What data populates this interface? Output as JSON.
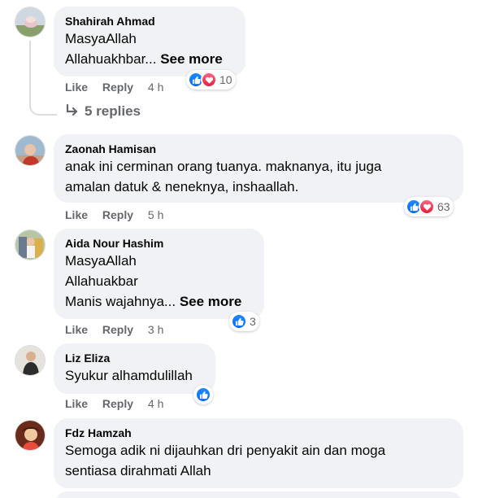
{
  "comments": [
    {
      "author": "Shahirah Ahmad",
      "lines": [
        "MasyaAllah",
        "Allahuakhbar..."
      ],
      "see_more": "See more",
      "actions": {
        "like": "Like",
        "reply": "Reply",
        "time": "4 h"
      },
      "reactions": {
        "types": [
          "like",
          "love"
        ],
        "count": "10"
      },
      "replies": "5 replies"
    },
    {
      "author": "Zaonah Hamisan",
      "lines": [
        "anak ini cerminan orang tuanya. maknanya, itu juga",
        "amalan datuk & neneknya, inshaallah."
      ],
      "actions": {
        "like": "Like",
        "reply": "Reply",
        "time": "5 h"
      },
      "reactions": {
        "types": [
          "like",
          "love"
        ],
        "count": "63"
      }
    },
    {
      "author": "Aida Nour Hashim",
      "lines": [
        "MasyaAllah",
        "Allahuakbar",
        "Manis wajahnya..."
      ],
      "see_more": "See more",
      "actions": {
        "like": "Like",
        "reply": "Reply",
        "time": "3 h"
      },
      "reactions": {
        "types": [
          "like"
        ],
        "count": "3"
      }
    },
    {
      "author": "Liz Eliza",
      "lines": [
        "Syukur alhamdulillah"
      ],
      "actions": {
        "like": "Like",
        "reply": "Reply",
        "time": "4 h"
      },
      "reactions": {
        "types": [
          "like"
        ],
        "count": ""
      }
    },
    {
      "author": "Fdz Hamzah",
      "lines": [
        "Semoga adik ni dijauhkan dri penyakit ain dan moga",
        "sentiasa dirahmati Allah"
      ]
    }
  ],
  "colors": {
    "bubble": "#f0f2f5",
    "meta": "#65676b",
    "like": "#0866ff",
    "love": "#e41e3f"
  },
  "icons": {
    "like": "thumbs-up-icon",
    "love": "heart-icon",
    "reply_arrow": "reply-arrow-icon"
  }
}
